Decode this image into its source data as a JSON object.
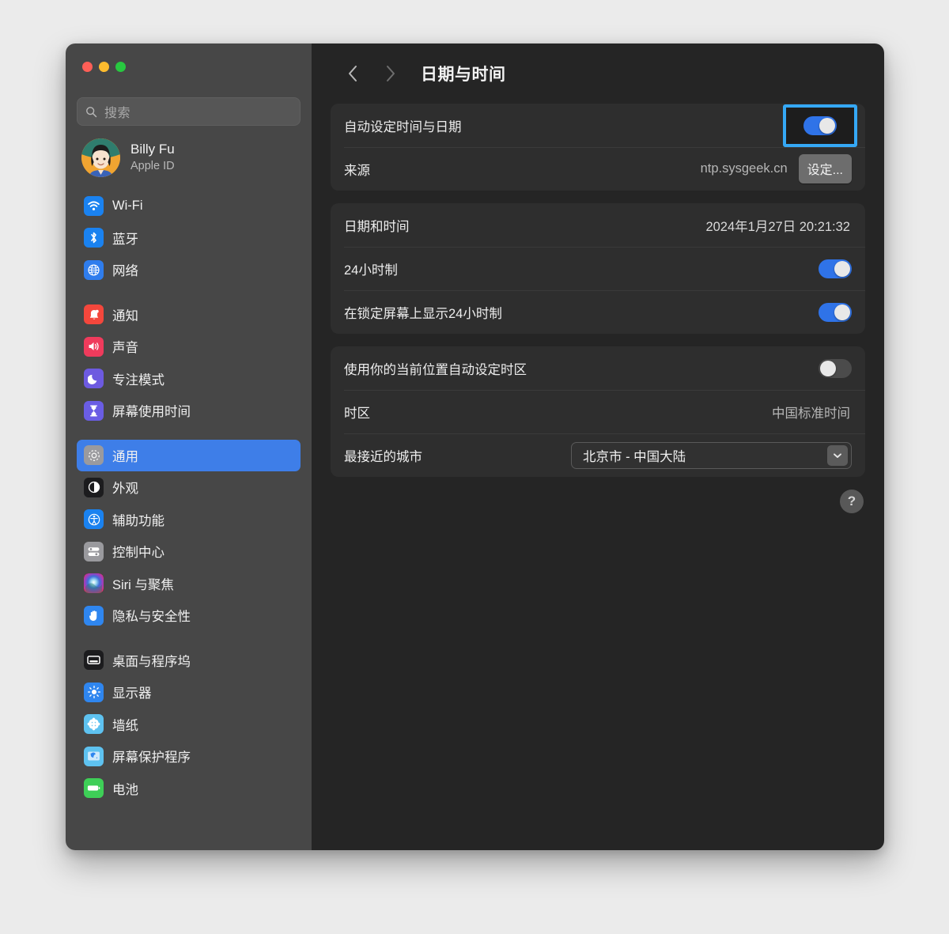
{
  "window": {
    "traffic_lights": [
      {
        "name": "close",
        "color": "#ff5f57"
      },
      {
        "name": "minimize",
        "color": "#febc2e"
      },
      {
        "name": "zoom",
        "color": "#28c840"
      }
    ]
  },
  "sidebar": {
    "search": {
      "placeholder": "搜索",
      "value": ""
    },
    "profile": {
      "name": "Billy Fu",
      "subtitle": "Apple ID"
    },
    "groups": [
      {
        "items": [
          {
            "label": "Wi-Fi",
            "icon": "wifi-icon",
            "color": "#1a82f0",
            "selected": false
          },
          {
            "label": "蓝牙",
            "icon": "bluetooth-icon",
            "color": "#1a82f0",
            "selected": false
          },
          {
            "label": "网络",
            "icon": "globe-icon",
            "color": "#2f7ded",
            "selected": false
          }
        ]
      },
      {
        "items": [
          {
            "label": "通知",
            "icon": "bell-icon",
            "color": "#f4473c",
            "selected": false
          },
          {
            "label": "声音",
            "icon": "speaker-icon",
            "color": "#ef3b5c",
            "selected": false
          },
          {
            "label": "专注模式",
            "icon": "moon-icon",
            "color": "#6d5ae0",
            "selected": false
          },
          {
            "label": "屏幕使用时间",
            "icon": "hourglass-icon",
            "color": "#6a5de4",
            "selected": false
          }
        ]
      },
      {
        "items": [
          {
            "label": "通用",
            "icon": "gear-icon",
            "color": "#8e8e93",
            "selected": true
          },
          {
            "label": "外观",
            "icon": "appearance-icon",
            "color": "#1c1c1e",
            "selected": false
          },
          {
            "label": "辅助功能",
            "icon": "accessibility-icon",
            "color": "#1a82f0",
            "selected": false
          },
          {
            "label": "控制中心",
            "icon": "control-center-icon",
            "color": "#8e8e93",
            "selected": false
          },
          {
            "label": "Siri 与聚焦",
            "icon": "siri-icon",
            "color": "#8e44ad",
            "selected": false
          },
          {
            "label": "隐私与安全性",
            "icon": "hand-icon",
            "color": "#2f86ef",
            "selected": false
          }
        ]
      },
      {
        "items": [
          {
            "label": "桌面与程序坞",
            "icon": "desktop-dock-icon",
            "color": "#1c1c1e",
            "selected": false
          },
          {
            "label": "显示器",
            "icon": "brightness-icon",
            "color": "#2f86ef",
            "selected": false
          },
          {
            "label": "墙纸",
            "icon": "wallpaper-icon",
            "color": "#5ec2f0",
            "selected": false
          },
          {
            "label": "屏幕保护程序",
            "icon": "screensaver-icon",
            "color": "#5ec2f0",
            "selected": false
          },
          {
            "label": "电池",
            "icon": "battery-icon",
            "color": "#3ecf57",
            "selected": false
          }
        ]
      }
    ]
  },
  "main": {
    "nav": {
      "back": "‹",
      "forward": "›"
    },
    "title": "日期与时间",
    "groups": [
      {
        "rows": [
          {
            "kind": "toggle",
            "label": "自动设定时间与日期",
            "state": "on",
            "highlighted": true
          },
          {
            "kind": "value-button",
            "label": "来源",
            "value": "ntp.sysgeek.cn",
            "button": "设定..."
          }
        ]
      },
      {
        "rows": [
          {
            "kind": "value",
            "label": "日期和时间",
            "value": "2024年1月27日 20:21:32"
          },
          {
            "kind": "toggle",
            "label": "24小时制",
            "state": "on",
            "highlighted": false
          },
          {
            "kind": "toggle",
            "label": "在锁定屏幕上显示24小时制",
            "state": "on",
            "highlighted": false
          }
        ]
      },
      {
        "rows": [
          {
            "kind": "toggle",
            "label": "使用你的当前位置自动设定时区",
            "state": "off",
            "highlighted": false
          },
          {
            "kind": "value",
            "label": "时区",
            "value": "中国标准时间"
          },
          {
            "kind": "select",
            "label": "最接近的城市",
            "value": "北京市 - 中国大陆"
          }
        ]
      }
    ],
    "help_label": "?"
  },
  "colors": {
    "accent_blue": "#2f73e8",
    "selection_blue": "#3e7ee8",
    "highlight_blue": "#35a8f5",
    "sidebar_bg": "#474747",
    "content_bg": "#252525",
    "card_bg": "#2e2e2e"
  }
}
